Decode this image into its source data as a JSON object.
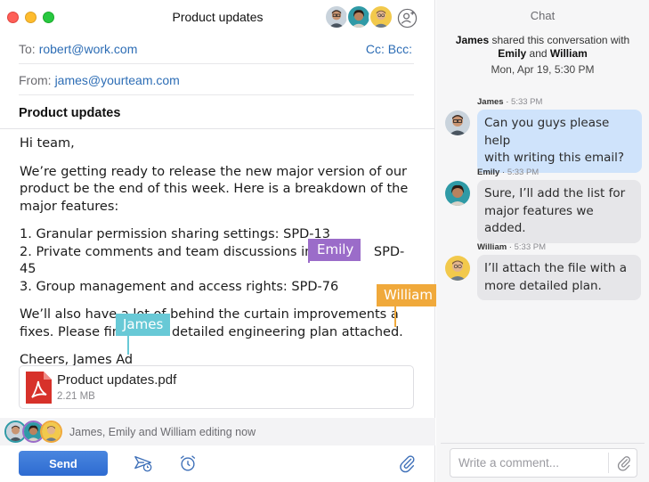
{
  "window": {
    "title": "Product updates"
  },
  "compose": {
    "to_label": "To:",
    "to_value": "robert@work.com",
    "cc_bcc": "Cc: Bcc:",
    "from_label": "From:",
    "from_value": "james@yourteam.com",
    "subject": "Product updates",
    "body": {
      "greeting": "Hi team,",
      "para1": "We’re getting ready to release the new major version of our product be the end of this week. Here is a breakdown of the major features:",
      "list": [
        "1. Granular permission sharing settings: SPD-13",
        "2. Private comments and team discussions in c",
        "SPD-45",
        "3. Group management and access rights: SPD-76"
      ],
      "para2_line1": "We’ll also have a lot of behind the curtain improvements a",
      "para2_line2a": "fixes. Please fin",
      "para2_line2b": "detailed engineering plan attached.",
      "signoff": "Cheers, James Ad"
    },
    "cursors": {
      "emily": {
        "name": "Emily",
        "color": "#9b6cc9"
      },
      "william": {
        "name": "William",
        "color": "#f0a93b"
      },
      "james": {
        "name": "James",
        "color": "#68c9d6"
      }
    },
    "attachment": {
      "name": "Product updates.pdf",
      "size": "2.21 MB",
      "icon": "pdf-icon"
    },
    "editing_status": "James, Emily and William editing now",
    "send_label": "Send"
  },
  "chat": {
    "title": "Chat",
    "share_pre": "James",
    "share_mid": " shared this conversation with",
    "share_name1": "Emily",
    "share_and": " and ",
    "share_name2": "William",
    "share_date": "Mon, Apr 19, 5:30 PM",
    "messages": [
      {
        "author": "James",
        "time": "5:33 PM",
        "line1": "Can you guys please help",
        "line2": "with writing this email?"
      },
      {
        "author": "Emily",
        "time": "5:33 PM",
        "line1": "Sure, I’ll add the list for",
        "line2": "major features we added."
      },
      {
        "author": "William",
        "time": "5:33 PM",
        "line1": "I’ll attach the file with a",
        "line2": "more detailed plan."
      }
    ],
    "comment_placeholder": "Write a comment..."
  },
  "colors": {
    "accent_blue": "#2d6db5",
    "send_button": "#3a78d8",
    "my_bubble": "#cfe3fb",
    "other_bubble": "#e6e6e9"
  }
}
